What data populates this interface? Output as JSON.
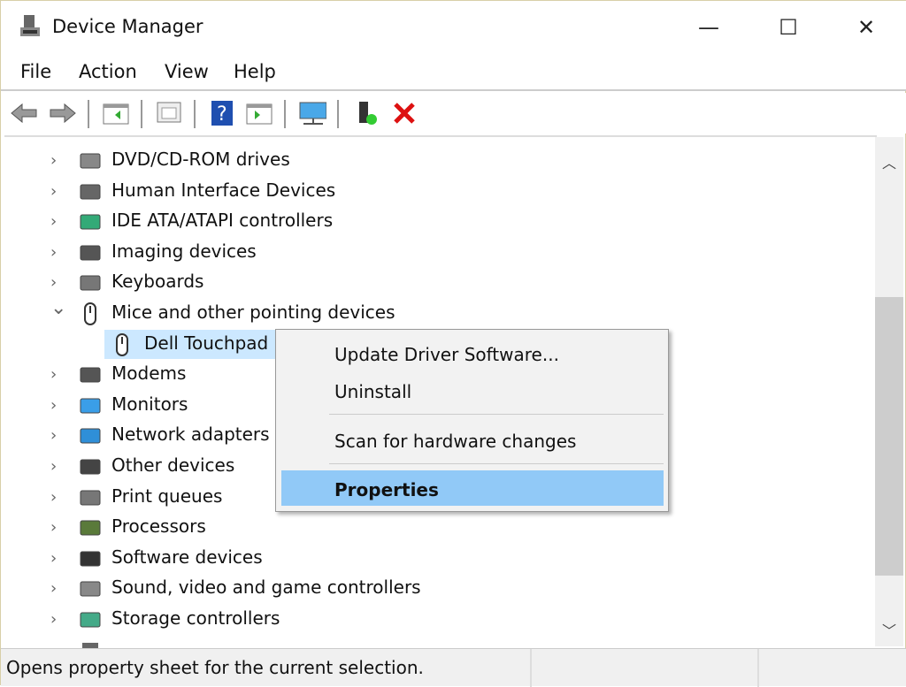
{
  "window": {
    "title": "Device Manager",
    "minimize": "—",
    "maximize": "☐",
    "close": "✕"
  },
  "menu": [
    "File",
    "Action",
    "View",
    "Help"
  ],
  "toolbar": [
    "back-icon",
    "forward-icon",
    "show-hide-console-tree-icon",
    "properties-icon",
    "help-icon",
    "show-action-pane-icon",
    "scan-hardware-icon",
    "update-driver-icon",
    "uninstall-icon"
  ],
  "tree": {
    "items": [
      {
        "label": "DVD/CD-ROM drives",
        "icon": "dvd-drive-icon",
        "expanded": false
      },
      {
        "label": "Human Interface Devices",
        "icon": "hid-icon",
        "expanded": false
      },
      {
        "label": "IDE ATA/ATAPI controllers",
        "icon": "ide-controller-icon",
        "expanded": false
      },
      {
        "label": "Imaging devices",
        "icon": "camera-icon",
        "expanded": false
      },
      {
        "label": "Keyboards",
        "icon": "keyboard-icon",
        "expanded": false
      },
      {
        "label": "Mice and other pointing devices",
        "icon": "mouse-icon",
        "expanded": true
      },
      {
        "label": "Modems",
        "icon": "modem-icon",
        "expanded": false
      },
      {
        "label": "Monitors",
        "icon": "monitor-icon",
        "expanded": false
      },
      {
        "label": "Network adapters",
        "icon": "network-icon",
        "expanded": false
      },
      {
        "label": "Other devices",
        "icon": "unknown-device-icon",
        "expanded": false
      },
      {
        "label": "Print queues",
        "icon": "printer-icon",
        "expanded": false
      },
      {
        "label": "Processors",
        "icon": "cpu-icon",
        "expanded": false
      },
      {
        "label": "Software devices",
        "icon": "software-device-icon",
        "expanded": false
      },
      {
        "label": "Sound, video and game controllers",
        "icon": "speaker-icon",
        "expanded": false
      },
      {
        "label": "Storage controllers",
        "icon": "storage-icon",
        "expanded": false
      }
    ],
    "child": {
      "label": "Dell Touchpad",
      "icon": "mouse-icon",
      "selected": true
    }
  },
  "context_menu": {
    "items": [
      "Update Driver Software...",
      "Uninstall",
      "Scan for hardware changes",
      "Properties"
    ],
    "highlighted": "Properties"
  },
  "status": {
    "text": "Opens property sheet for the current selection."
  },
  "colors": {
    "selection": "#cce8ff",
    "menu_highlight": "#91c9f7"
  }
}
